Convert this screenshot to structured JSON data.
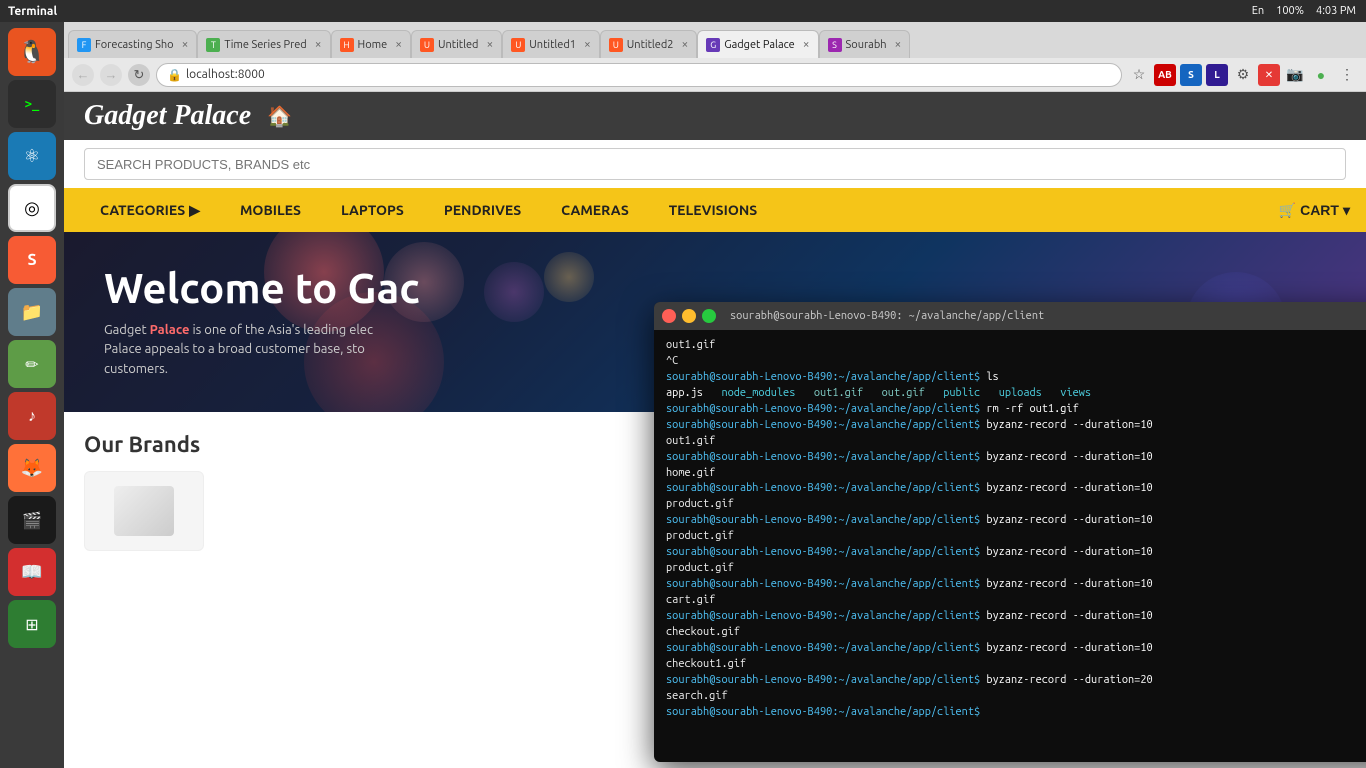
{
  "taskbar": {
    "left_label": "Terminal",
    "time": "4:03 PM",
    "battery": "100%",
    "keyboard_layout": "En"
  },
  "browser": {
    "tabs": [
      {
        "id": "tab-forecasting",
        "label": "Forecasting Sho",
        "favicon_color": "#2196F3",
        "active": false
      },
      {
        "id": "tab-timeseries",
        "label": "Time Series Pred",
        "favicon_color": "#4CAF50",
        "active": false
      },
      {
        "id": "tab-home",
        "label": "Home",
        "favicon_color": "#FF5722",
        "active": false
      },
      {
        "id": "tab-untitled1",
        "label": "Untitled",
        "favicon_color": "#FF5722",
        "active": false
      },
      {
        "id": "tab-untitled2",
        "label": "Untitled1",
        "favicon_color": "#FF5722",
        "active": false
      },
      {
        "id": "tab-untitled3",
        "label": "Untitled2",
        "favicon_color": "#FF5722",
        "active": false
      },
      {
        "id": "tab-gadget",
        "label": "Gadget Palace",
        "favicon_color": "#673AB7",
        "active": true
      },
      {
        "id": "tab-sourabh",
        "label": "Sourabh",
        "favicon_color": "#9C27B0",
        "active": false
      }
    ],
    "url": "localhost:8000"
  },
  "website": {
    "title": "Gadget Palace",
    "search_placeholder": "SEARCH PRODUCTS, BRANDS etc",
    "nav": {
      "items": [
        {
          "id": "categories",
          "label": "CATEGORIES",
          "has_arrow": true
        },
        {
          "id": "mobiles",
          "label": "MOBILES",
          "has_arrow": false
        },
        {
          "id": "laptops",
          "label": "LAPTOPS",
          "has_arrow": false
        },
        {
          "id": "pendrives",
          "label": "PENDRIVES",
          "has_arrow": false
        },
        {
          "id": "cameras",
          "label": "CAMERAS",
          "has_arrow": false
        },
        {
          "id": "televisions",
          "label": "TELEVISIONS",
          "has_arrow": false
        }
      ],
      "cart_label": "CART"
    },
    "hero": {
      "title": "Welcome to Gac",
      "subtitle_plain": "Gadget Palace is one of the Asia's leading elec",
      "subtitle_highlight": "Palace",
      "subtitle_rest": " appeals to a broad customer base, sto customers."
    },
    "brands": {
      "title": "Our Brands"
    }
  },
  "terminal": {
    "title": "sourabh@sourabh-Lenovo-B490: ~/avalanche/app/client",
    "lines": [
      {
        "type": "output",
        "text": "out1.gif"
      },
      {
        "type": "output",
        "text": "^C"
      },
      {
        "type": "prompt",
        "text": "sourabh@sourabh-Lenovo-B490:~/avalanche/app/client$ ls"
      },
      {
        "type": "output_colored",
        "items": [
          "app.js",
          "node_modules",
          "out1.gif",
          "out.gif",
          "public",
          "uploads",
          "views"
        ]
      },
      {
        "type": "prompt",
        "text": "sourabh@sourabh-Lenovo-B490:~/avalanche/app/client$ rm -rf out1.gif"
      },
      {
        "type": "prompt",
        "text": "sourabh@sourabh-Lenovo-B490:~/avalanche/app/client$ byzanz-record --duration=10 out1.gif"
      },
      {
        "type": "prompt",
        "text": "sourabh@sourabh-Lenovo-B490:~/avalanche/app/client$ byzanz-record --duration=10 home.gif"
      },
      {
        "type": "prompt",
        "text": "sourabh@sourabh-Lenovo-B490:~/avalanche/app/client$ byzanz-record --duration=10 product.gif"
      },
      {
        "type": "prompt",
        "text": "sourabh@sourabh-Lenovo-B490:~/avalanche/app/client$ byzanz-record --duration=10 product.gif"
      },
      {
        "type": "prompt",
        "text": "sourabh@sourabh-Lenovo-B490:~/avalanche/app/client$ byzanz-record --duration=10 product.gif"
      },
      {
        "type": "prompt",
        "text": "sourabh@sourabh-Lenovo-B490:~/avalanche/app/client$ byzanz-record --duration=10 cart.gif"
      },
      {
        "type": "prompt",
        "text": "sourabh@sourabh-Lenovo-B490:~/avalanche/app/client$ byzanz-record --duration=10 checkout.gif"
      },
      {
        "type": "prompt",
        "text": "sourabh@sourabh-Lenovo-B490:~/avalanche/app/client$ byzanz-record --duration=10 checkout1.gif"
      },
      {
        "type": "prompt",
        "text": "sourabh@sourabh-Lenovo-B490:~/avalanche/app/client$ byzanz-record --duration=20 search.gif"
      },
      {
        "type": "cursor",
        "text": ""
      }
    ]
  },
  "dock": {
    "items": [
      {
        "id": "ubuntu",
        "icon": "🐧",
        "color": "#e95420"
      },
      {
        "id": "terminal",
        "icon": ">_",
        "color": "#2d2d2d"
      },
      {
        "id": "atom",
        "icon": "⚛",
        "color": "#1a7ab5"
      },
      {
        "id": "chrome",
        "icon": "◎",
        "color": "#e94235"
      },
      {
        "id": "sublime",
        "icon": "S",
        "color": "#f75b34"
      },
      {
        "id": "files",
        "icon": "🗂",
        "color": "#607D8B"
      },
      {
        "id": "text",
        "icon": "✏",
        "color": "#5e9c47"
      },
      {
        "id": "sound",
        "icon": "♪",
        "color": "#c0392b"
      },
      {
        "id": "firefox",
        "icon": "🦊",
        "color": "#ff7139"
      },
      {
        "id": "video",
        "icon": "🎬",
        "color": "#1a1a1a"
      },
      {
        "id": "ebook",
        "icon": "📖",
        "color": "#d32f2f"
      },
      {
        "id": "calc",
        "icon": "🔢",
        "color": "#2e7d32"
      }
    ]
  }
}
